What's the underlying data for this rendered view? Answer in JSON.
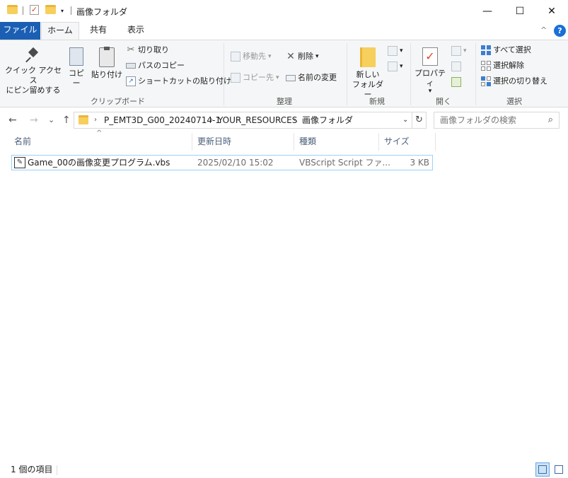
{
  "window": {
    "title": "画像フォルダ",
    "qa_separator": "|",
    "qa_dropdown": "▾",
    "minimize": "—",
    "maximize": "☐",
    "close": "✕"
  },
  "tabs": [
    {
      "label": "ファイル"
    },
    {
      "label": "ホーム"
    },
    {
      "label": "共有"
    },
    {
      "label": "表示"
    }
  ],
  "ribbon": {
    "collapse": "^",
    "help": "?",
    "clipboard": {
      "label": "クリップボード",
      "pin_line1": "クイック アクセス",
      "pin_line2": "にピン留めする",
      "copy": "コピー",
      "paste": "貼り付け",
      "cut": "切り取り",
      "copy_path": "パスのコピー",
      "paste_shortcut": "ショートカットの貼り付け"
    },
    "organize": {
      "label": "整理",
      "move_to": "移動先",
      "copy_to": "コピー先",
      "delete": "削除",
      "rename": "名前の変更",
      "dropdown": "▾"
    },
    "new": {
      "label": "新規",
      "new_folder_line1": "新しい",
      "new_folder_line2": "フォルダー"
    },
    "open": {
      "label": "開く",
      "properties": "プロパティ"
    },
    "select": {
      "label": "選択",
      "select_all": "すべて選択",
      "select_none": "選択解除",
      "invert": "選択の切り替え"
    }
  },
  "navigation": {
    "back": "←",
    "forward": "→",
    "recent": "⌄",
    "up": "↑",
    "breadcrumb": [
      "P_EMT3D_G00_20240714-1",
      "YOUR_RESOURCES",
      "画像フォルダ"
    ],
    "separator": "›",
    "dropdown": "⌄",
    "refresh": "↻",
    "search_placeholder": "画像フォルダの検索",
    "search_icon": "⌕"
  },
  "columns": {
    "sort_indicator": "^",
    "name": "名前",
    "modified": "更新日時",
    "type": "種類",
    "size": "サイズ"
  },
  "files": [
    {
      "icon": "vbs-file-icon",
      "name": "Game_00の画像変更プログラム.vbs",
      "modified": "2025/02/10 15:02",
      "type": "VBScript Script ファ...",
      "size": "3 KB"
    }
  ],
  "status": {
    "item_count": "1 個の項目"
  },
  "colors": {
    "accent": "#1a5fb4",
    "selection_border": "#99d1ff",
    "folder": "#f6cf5c"
  }
}
